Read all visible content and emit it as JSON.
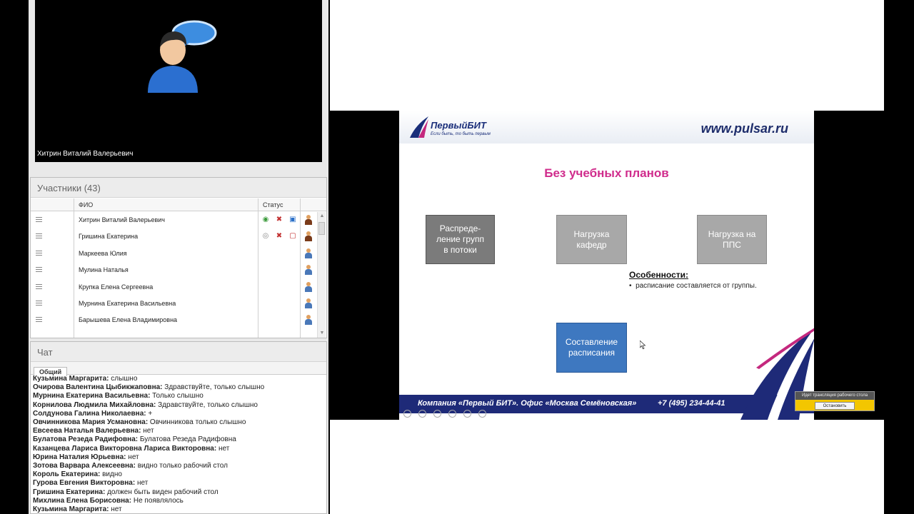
{
  "video": {
    "presenter_name": "Хитрин Виталий Валерьевич"
  },
  "participants": {
    "header": "Участники (43)",
    "columns": {
      "fio": "ФИО",
      "status": "Статус"
    },
    "rows": [
      {
        "name": "Хитрин Виталий Валерьевич",
        "status_icons": [
          "webcam-icon",
          "mic-off-icon",
          "screen-share-icon"
        ],
        "role": "presenter"
      },
      {
        "name": "Гришина Екатерина",
        "status_icons": [
          "webcam-off-icon",
          "mic-off-icon",
          "screen-share-off-icon"
        ],
        "role": "presenter"
      },
      {
        "name": "Маркеева Юлия",
        "status_icons": [],
        "role": "attendee"
      },
      {
        "name": "Мулина Наталья",
        "status_icons": [],
        "role": "attendee"
      },
      {
        "name": "Крупка Елена Сергеевна",
        "status_icons": [],
        "role": "attendee"
      },
      {
        "name": "Мурнина Екатерина Васильевна",
        "status_icons": [],
        "role": "attendee"
      },
      {
        "name": "Барышева Елена    Владимировна",
        "status_icons": [],
        "role": "attendee"
      }
    ]
  },
  "chat": {
    "header": "Чат",
    "tab": "Общий",
    "messages": [
      {
        "author": "Кузьмина  Маргарита:",
        "text": " слышно"
      },
      {
        "author": "Очирова Валентина Цыбикжаповна:",
        "text": " Здравствуйте, только слышно"
      },
      {
        "author": "Мурнина Екатерина Васильевна:",
        "text": " Только слышно"
      },
      {
        "author": "Корнилова Людмила Михайловна:",
        "text": " Здравствуйте, только слышно"
      },
      {
        "author": "Солдунова Галина Николаевна:",
        "text": " +"
      },
      {
        "author": "Овчинникова Мария Усмановна:",
        "text": " Овчинникова  только слышно"
      },
      {
        "author": "Евсеева Наталья Валерьевна:",
        "text": " нет"
      },
      {
        "author": "Булатова Резеда Радифовна:",
        "text": " Булатова Резеда Радифовна"
      },
      {
        "author": "Казанцева Лариса Викторовна  Лариса Викторовна:",
        "text": " нет"
      },
      {
        "author": "Юрина Наталия Юрьевна:",
        "text": " нет"
      },
      {
        "author": "Зотова Варвара  Алексеевна:",
        "text": " видно только рабочий стол"
      },
      {
        "author": "Король Екатерина:",
        "text": " видно"
      },
      {
        "author": "Гурова Евгения Викторовна:",
        "text": " нет"
      },
      {
        "author": "Гришина Екатерина:",
        "text": " должен быть виден рабочий стол"
      },
      {
        "author": "Михлина Елена Борисовна:",
        "text": " Не появлялось"
      },
      {
        "author": "Кузьмина  Маргарита:",
        "text": " нет"
      }
    ]
  },
  "slide": {
    "logo_name": "ПервыйБИТ",
    "logo_tagline": "Если быть, то быть первым",
    "site": "www.pulsar.ru",
    "title": "Без учебных планов",
    "boxes": {
      "groups": "Распреде-\nление групп\nв потоки",
      "departments": "Нагрузка\nкафедр",
      "pps": "Нагрузка на\nППС",
      "schedule": "Составление\nрасписания"
    },
    "features_title": "Особенности:",
    "features": [
      "расписание составляется от группы."
    ],
    "footer_text": "Компания «Первый БИТ». Офис «Москва Семёновская»",
    "footer_phone": "+7 (495) 234-44-41"
  },
  "screen_share": {
    "status": "Идет трансляция рабочего стола",
    "stop_label": "Остановить"
  },
  "colors": {
    "slide_title": "#d02c8c",
    "footer_band": "#1e2a78",
    "box_blue": "#3e78c0",
    "share_bar": "#f3c600"
  }
}
